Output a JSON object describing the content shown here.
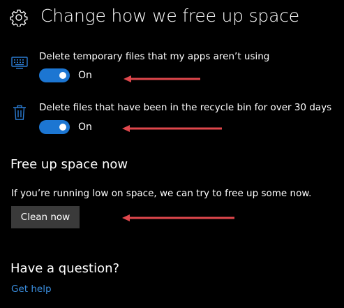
{
  "header": {
    "icon": "gear-icon",
    "title": "Change how we free up space"
  },
  "settings": [
    {
      "icon": "keyboard-icon",
      "label": "Delete temporary files that my apps aren’t using",
      "toggle_state": "On",
      "enabled": true
    },
    {
      "icon": "trash-icon",
      "label": "Delete files that have been in the recycle bin for over 30 days",
      "toggle_state": "On",
      "enabled": true
    }
  ],
  "free_up_now": {
    "heading": "Free up space now",
    "description": "If you’re running low on space, we can try to free up some now.",
    "button_label": "Clean now"
  },
  "help": {
    "heading": "Have a question?",
    "link_label": "Get help"
  },
  "colors": {
    "background": "#000000",
    "text": "#ffffff",
    "toggle_on": "#1c76d2",
    "icon_accent": "#2b7cd3",
    "link": "#3b8fe0",
    "button_bg": "#3a3a3a",
    "annotation_arrow": "#e0474c"
  }
}
